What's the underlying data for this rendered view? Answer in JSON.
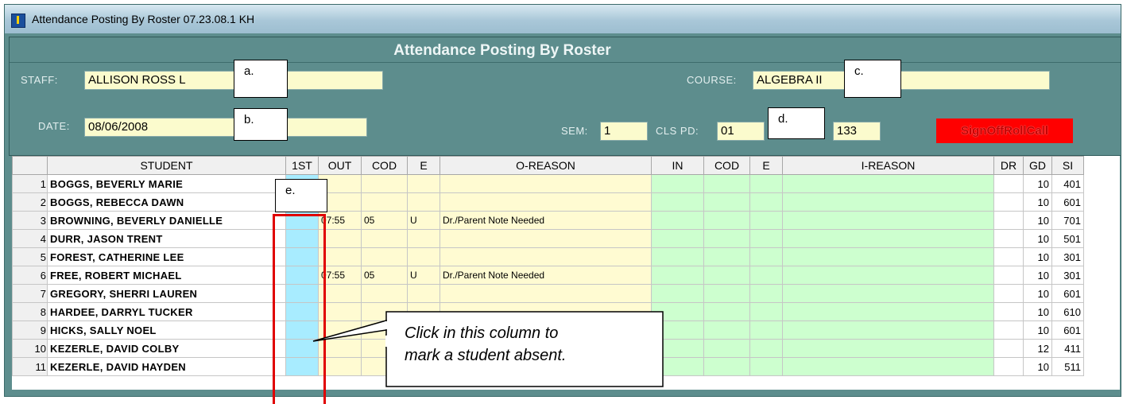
{
  "window": {
    "title": "Attendance Posting By Roster 07.23.08.1 KH"
  },
  "header": {
    "title": "Attendance Posting By Roster",
    "staff_label": "STAFF:",
    "staff_value": "ALLISON ROSS L",
    "date_label": "DATE:",
    "date_value": "08/06/2008",
    "course_label": "COURSE:",
    "course_value": "ALGEBRA II",
    "sem_label": "SEM:",
    "sem_value": "1",
    "clspd_label": "CLS PD:",
    "clspd_value": "01",
    "room_value": "133",
    "signoff_label": "SignOffRollCall"
  },
  "callouts": {
    "a": "a.",
    "b": "b.",
    "c": "c.",
    "d": "d.",
    "e": "e."
  },
  "instruction": {
    "line1": "Click in this column to",
    "line2": "mark a student absent."
  },
  "grid": {
    "columns": [
      "",
      "STUDENT",
      "1ST",
      "OUT",
      "COD",
      "E",
      "O-REASON",
      "IN",
      "COD",
      "E",
      "I-REASON",
      "DR",
      "GD",
      "SI"
    ],
    "rows": [
      {
        "num": "1",
        "student": "BOGGS, BEVERLY MARIE",
        "first": "",
        "out": "",
        "cod": "",
        "e": "",
        "oreason": "",
        "in": "",
        "icod": "",
        "ie": "",
        "ireason": "",
        "dr": "",
        "gd": "10",
        "si": "401"
      },
      {
        "num": "2",
        "student": "BOGGS, REBECCA DAWN",
        "first": "",
        "out": "",
        "cod": "",
        "e": "",
        "oreason": "",
        "in": "",
        "icod": "",
        "ie": "",
        "ireason": "",
        "dr": "",
        "gd": "10",
        "si": "601"
      },
      {
        "num": "3",
        "student": "BROWNING, BEVERLY DANIELLE",
        "first": "",
        "out": "07:55",
        "cod": "05",
        "e": "U",
        "oreason": "Dr./Parent Note Needed",
        "in": "",
        "icod": "",
        "ie": "",
        "ireason": "",
        "dr": "",
        "gd": "10",
        "si": "701"
      },
      {
        "num": "4",
        "student": "DURR, JASON TRENT",
        "first": "",
        "out": "",
        "cod": "",
        "e": "",
        "oreason": "",
        "in": "",
        "icod": "",
        "ie": "",
        "ireason": "",
        "dr": "",
        "gd": "10",
        "si": "501"
      },
      {
        "num": "5",
        "student": "FOREST, CATHERINE LEE",
        "first": "",
        "out": "",
        "cod": "",
        "e": "",
        "oreason": "",
        "in": "",
        "icod": "",
        "ie": "",
        "ireason": "",
        "dr": "",
        "gd": "10",
        "si": "301"
      },
      {
        "num": "6",
        "student": "FREE, ROBERT MICHAEL",
        "first": "",
        "out": "07:55",
        "cod": "05",
        "e": "U",
        "oreason": "Dr./Parent Note Needed",
        "in": "",
        "icod": "",
        "ie": "",
        "ireason": "",
        "dr": "",
        "gd": "10",
        "si": "301"
      },
      {
        "num": "7",
        "student": "GREGORY, SHERRI LAUREN",
        "first": "",
        "out": "",
        "cod": "",
        "e": "",
        "oreason": "",
        "in": "",
        "icod": "",
        "ie": "",
        "ireason": "",
        "dr": "",
        "gd": "10",
        "si": "601"
      },
      {
        "num": "8",
        "student": "HARDEE, DARRYL TUCKER",
        "first": "",
        "out": "",
        "cod": "",
        "e": "",
        "oreason": "",
        "in": "",
        "icod": "",
        "ie": "",
        "ireason": "",
        "dr": "",
        "gd": "10",
        "si": "610"
      },
      {
        "num": "9",
        "student": "HICKS, SALLY NOEL",
        "first": "",
        "out": "",
        "cod": "",
        "e": "",
        "oreason": "",
        "in": "",
        "icod": "",
        "ie": "",
        "ireason": "",
        "dr": "",
        "gd": "10",
        "si": "601"
      },
      {
        "num": "10",
        "student": "KEZERLE, DAVID COLBY",
        "first": "",
        "out": "",
        "cod": "",
        "e": "",
        "oreason": "",
        "in": "",
        "icod": "",
        "ie": "",
        "ireason": "",
        "dr": "",
        "gd": "12",
        "si": "411"
      },
      {
        "num": "11",
        "student": "KEZERLE, DAVID HAYDEN",
        "first": "",
        "out": "",
        "cod": "",
        "e": "",
        "oreason": "",
        "in": "",
        "icod": "",
        "ie": "",
        "ireason": "",
        "dr": "",
        "gd": "10",
        "si": "511"
      }
    ]
  }
}
